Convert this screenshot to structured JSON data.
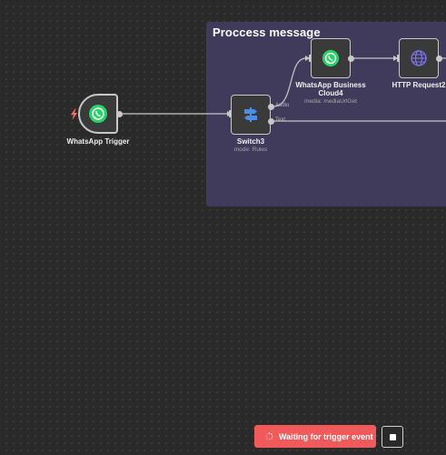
{
  "canvas": {
    "sticky": {
      "title": "Proccess message",
      "color": "#403a5b"
    }
  },
  "nodes": {
    "trigger": {
      "label": "WhatsApp Trigger",
      "icon": "whatsapp-icon",
      "badge_icon": "lightning-bolt-icon",
      "badge_color": "#ff6d5a"
    },
    "switch": {
      "label": "Switch3",
      "subtitle": "mode: Rules",
      "icon": "switch-signpost-icon",
      "outputs": [
        "Audio",
        "Text"
      ]
    },
    "whatsapp_business": {
      "label_line1": "WhatsApp Business",
      "label_line2": "Cloud4",
      "subtitle": "media: mediaUrlGet",
      "icon": "whatsapp-icon"
    },
    "http_request": {
      "label": "HTTP Request2",
      "icon": "globe-icon"
    }
  },
  "footer": {
    "wait_button_label": "Waiting for trigger event",
    "wait_button_color": "#f05a5a",
    "stop_button": "stop-icon"
  }
}
